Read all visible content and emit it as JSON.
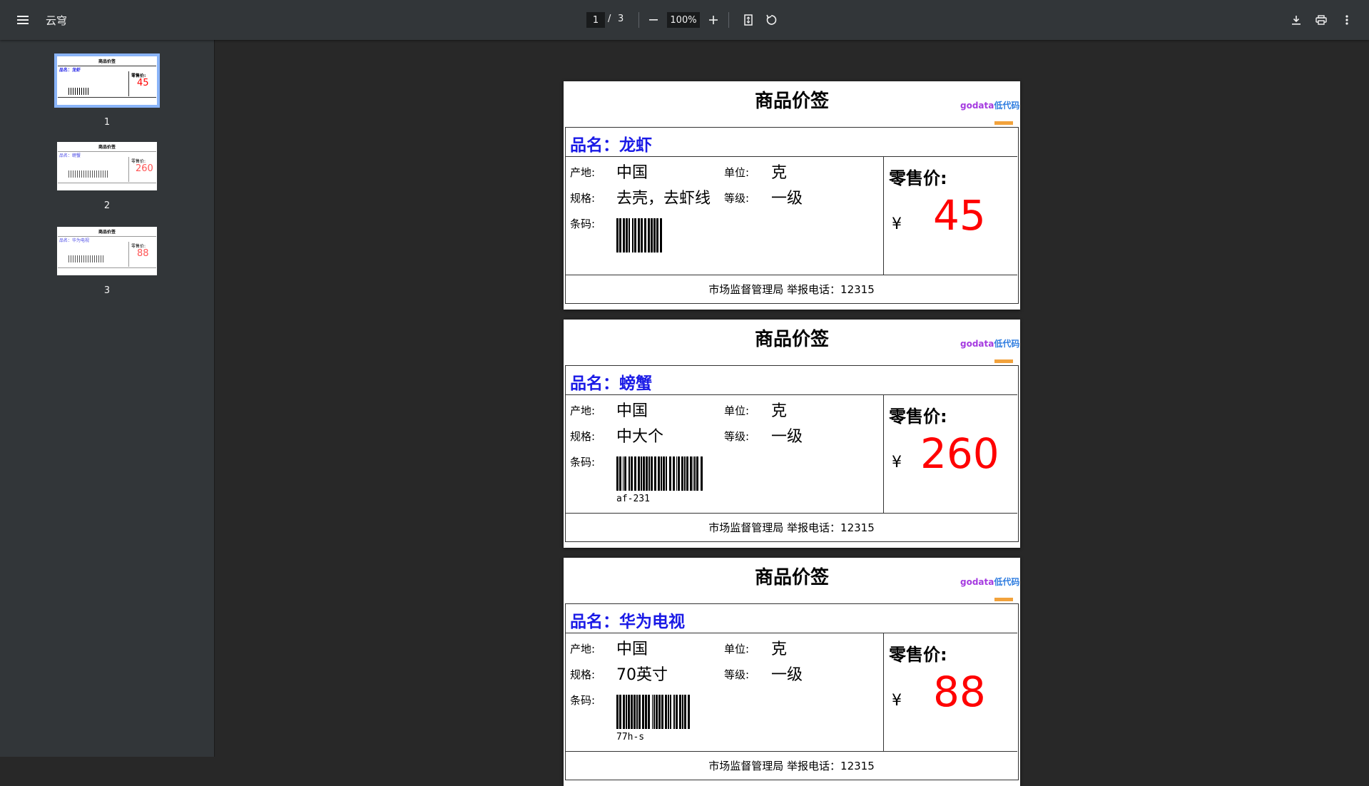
{
  "toolbar": {
    "title": "云穹",
    "current_page": "1",
    "page_separator": "/",
    "total_pages": "3",
    "zoom": "100%"
  },
  "thumbnails": [
    {
      "number": "1",
      "selected": true
    },
    {
      "number": "2",
      "selected": false
    },
    {
      "number": "3",
      "selected": false
    }
  ],
  "pages": [
    {
      "title": "商品价签",
      "logo_a": "godata",
      "logo_b": "低代码",
      "name": "品名：龙虾",
      "origin_label": "产地:",
      "origin": "中国",
      "unit_label": "单位:",
      "unit": "克",
      "spec_label": "规格:",
      "spec": "去壳，去虾线",
      "grade_label": "等级:",
      "grade": "一级",
      "barcode_label": "条码:",
      "barcode_text": "",
      "price_label": "零售价:",
      "currency": "¥",
      "price": "45",
      "footer": "市场监督管理局 举报电话：12315"
    },
    {
      "title": "商品价签",
      "logo_a": "godata",
      "logo_b": "低代码",
      "name": "品名：螃蟹",
      "origin_label": "产地:",
      "origin": "中国",
      "unit_label": "单位:",
      "unit": "克",
      "spec_label": "规格:",
      "spec": "中大个",
      "grade_label": "等级:",
      "grade": "一级",
      "barcode_label": "条码:",
      "barcode_text": "af-231",
      "price_label": "零售价:",
      "currency": "¥",
      "price": "260",
      "footer": "市场监督管理局 举报电话：12315"
    },
    {
      "title": "商品价签",
      "logo_a": "godata",
      "logo_b": "低代码",
      "name": "品名：华为电视",
      "origin_label": "产地:",
      "origin": "中国",
      "unit_label": "单位:",
      "unit": "克",
      "spec_label": "规格:",
      "spec": "70英寸",
      "grade_label": "等级:",
      "grade": "一级",
      "barcode_label": "条码:",
      "barcode_text": "77h-s",
      "price_label": "零售价:",
      "currency": "¥",
      "price": "88",
      "footer": "市场监督管理局 举报电话：12315"
    }
  ]
}
